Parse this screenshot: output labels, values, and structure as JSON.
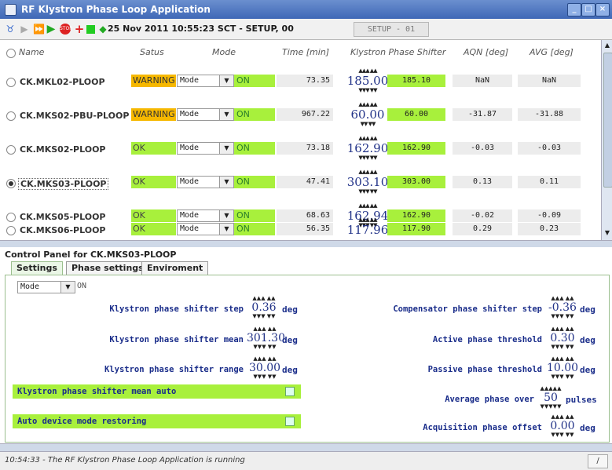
{
  "window": {
    "title": "RF Klystron Phase Loop Application"
  },
  "toolbar": {
    "status_text": "25 Nov 2011  10:55:23  SCT - SETUP, 00",
    "setup_field": "SETUP - 01"
  },
  "table": {
    "headers": {
      "name": "Name",
      "status": "Satus",
      "mode": "Mode",
      "time": "Time [min]",
      "klystron": "Klystron Phase Shifter",
      "aqn": "AQN [deg]",
      "avg": "AVG [deg]"
    },
    "rows": [
      {
        "name": "CK.MKL02-PLOOP",
        "status": "WARNING",
        "mode": "Mode",
        "on": "ON",
        "time": "73.35",
        "kps": "185.00",
        "shifter": "185.10",
        "aqn": "NaN",
        "avg": "NaN"
      },
      {
        "name": "CK.MKS02-PBU-PLOOP",
        "status": "WARNING",
        "mode": "Mode",
        "on": "ON",
        "time": "967.22",
        "kps": "60.00",
        "shifter": "60.00",
        "aqn": "-31.87",
        "avg": "-31.88"
      },
      {
        "name": "CK.MKS02-PLOOP",
        "status": "OK",
        "mode": "Mode",
        "on": "ON",
        "time": "73.18",
        "kps": "162.90",
        "shifter": "162.90",
        "aqn": "-0.03",
        "avg": "-0.03"
      },
      {
        "name": "CK.MKS03-PLOOP",
        "status": "OK",
        "mode": "Mode",
        "on": "ON",
        "time": "47.41",
        "kps": "303.10",
        "shifter": "303.00",
        "aqn": "0.13",
        "avg": "0.11"
      },
      {
        "name": "CK.MKS05-PLOOP",
        "status": "OK",
        "mode": "Mode",
        "on": "ON",
        "time": "68.63",
        "kps": "162.94",
        "shifter": "162.90",
        "aqn": "-0.02",
        "avg": "-0.09"
      },
      {
        "name": "CK.MKS06-PLOOP",
        "status": "OK",
        "mode": "Mode",
        "on": "ON",
        "time": "56.35",
        "kps": "117.96",
        "shifter": "117.90",
        "aqn": "0.29",
        "avg": "0.23"
      }
    ]
  },
  "control_panel": {
    "title": "Control Panel for CK.MKS03-PLOOP",
    "tabs": [
      "Settings",
      "Phase settings",
      "Enviroment"
    ],
    "mode": "Mode",
    "on": "ON",
    "left_params": [
      {
        "label": "Klystron phase shifter step",
        "value": "0.36",
        "unit": "deg"
      },
      {
        "label": "Klystron phase shifter mean",
        "value": "301.30",
        "unit": "deg"
      },
      {
        "label": "Klystron phase shifter range",
        "value": "30.00",
        "unit": "deg"
      }
    ],
    "right_params": [
      {
        "label": "Compensator phase shifter step",
        "value": "-0.36",
        "unit": "deg"
      },
      {
        "label": "Active phase threshold",
        "value": "0.30",
        "unit": "deg"
      },
      {
        "label": "Passive phase threshold",
        "value": "10.00",
        "unit": "deg"
      },
      {
        "label": "Average phase over",
        "value": "50",
        "unit": "pulses"
      },
      {
        "label": "Acquisition phase offset",
        "value": "0.00",
        "unit": "deg"
      }
    ],
    "toggles": [
      {
        "label": "Klystron phase shifter mean auto"
      },
      {
        "label": "Auto device mode restoring"
      }
    ]
  },
  "statusbar": {
    "message": "10:54:33 - The RF Klystron Phase Loop Application is running",
    "button": "/"
  },
  "colors": {
    "ok": "#a8f03c",
    "warning": "#f6b800",
    "title_blue": "#3f68b6"
  }
}
